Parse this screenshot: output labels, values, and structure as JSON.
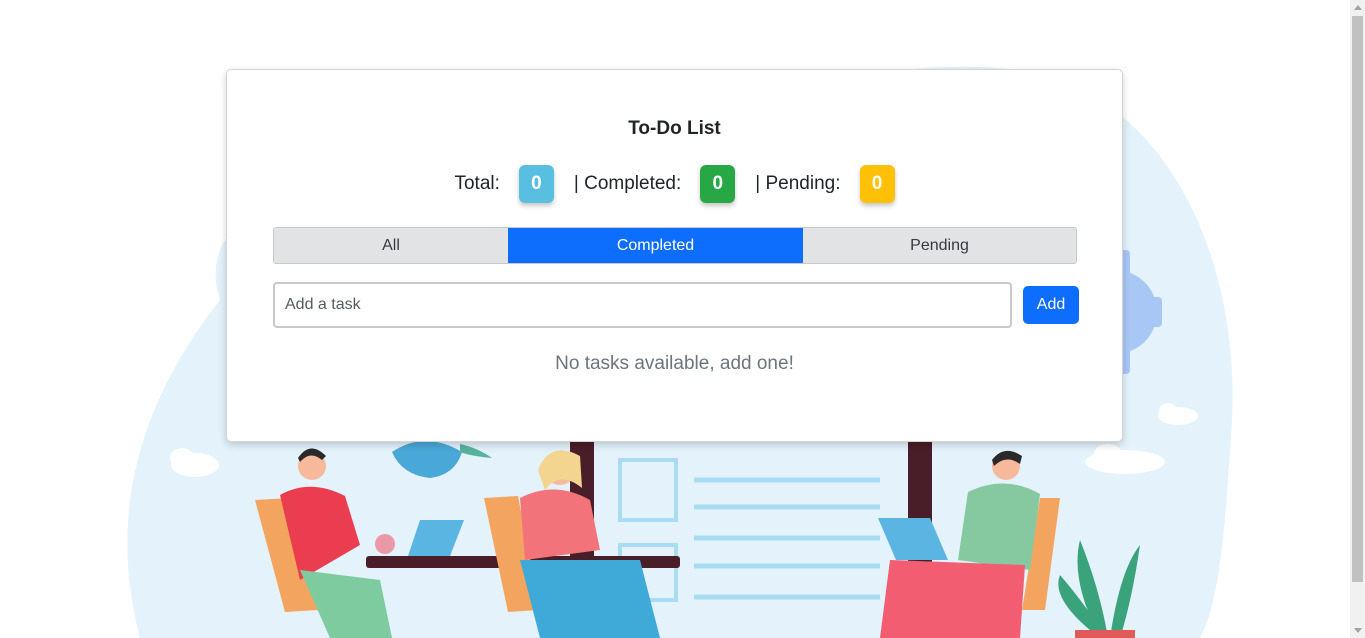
{
  "app": {
    "title": "To-Do List"
  },
  "stats": {
    "total_label": "Total:",
    "total_value": "0",
    "completed_label": "| Completed:",
    "completed_value": "0",
    "pending_label": "| Pending:",
    "pending_value": "0"
  },
  "tabs": [
    {
      "label": "All",
      "active": false
    },
    {
      "label": "Completed",
      "active": true
    },
    {
      "label": "Pending",
      "active": false
    }
  ],
  "task_input": {
    "value": "",
    "placeholder": "Add a task"
  },
  "add_button": {
    "label": "Add"
  },
  "empty_message": "No tasks available, add one!",
  "colors": {
    "primary": "#0d6efd",
    "badge_total": "#58bfe0",
    "badge_completed": "#28a745",
    "badge_pending": "#ffc107",
    "tab_inactive": "#e2e3e5"
  }
}
